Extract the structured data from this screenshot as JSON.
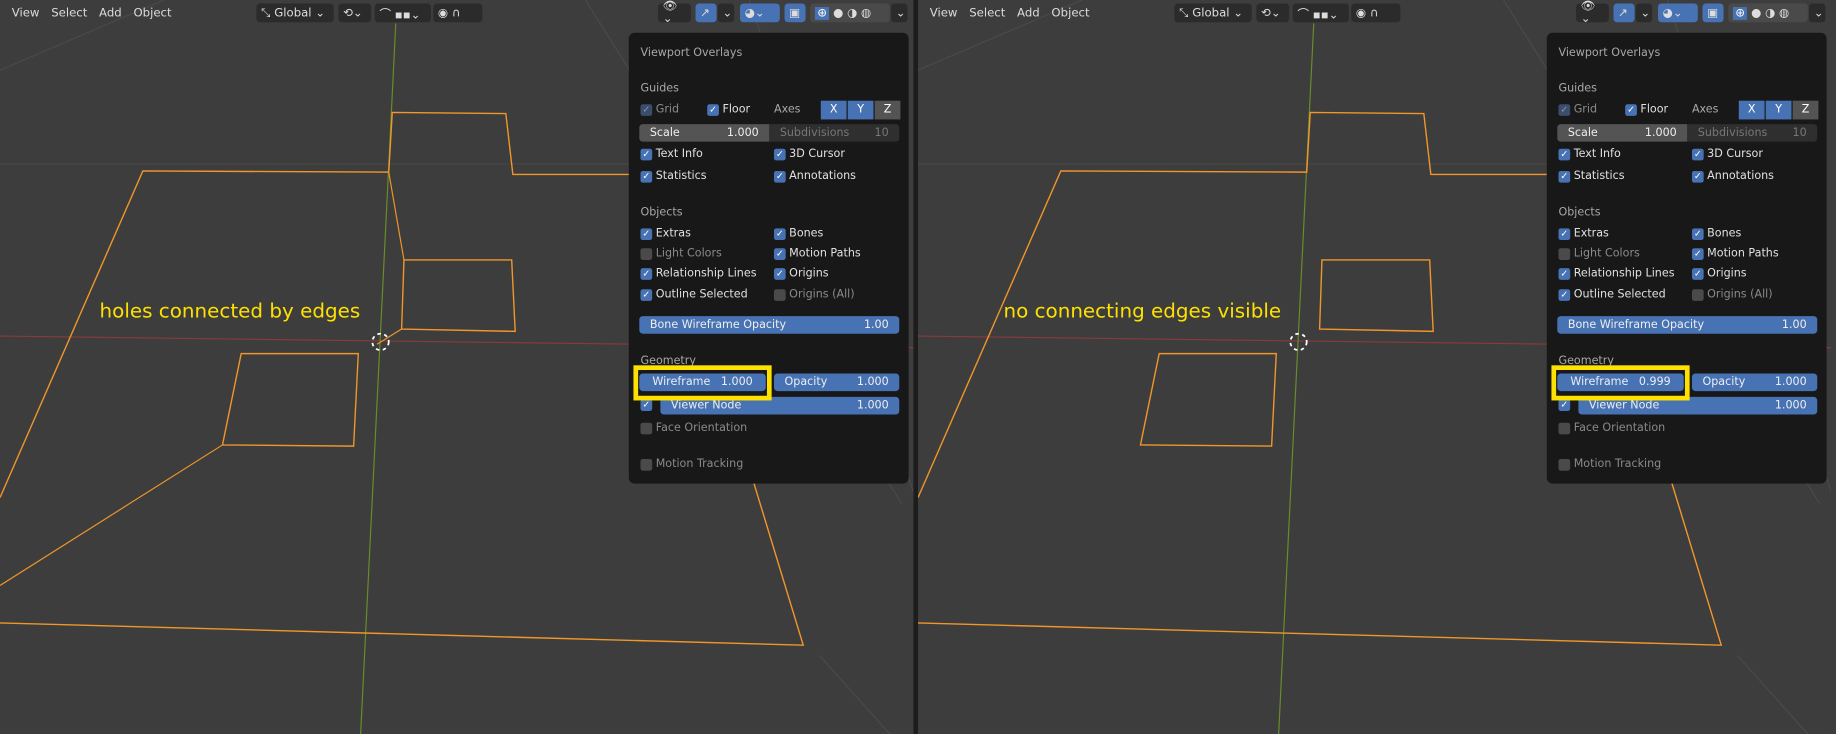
{
  "header": {
    "menus": [
      "View",
      "Select",
      "Add",
      "Object"
    ],
    "transform_orientation": "Global"
  },
  "panel": {
    "title": "Viewport Overlays",
    "guides": {
      "label": "Guides",
      "grid": "Grid",
      "floor": "Floor",
      "axes": "Axes",
      "axis_buttons": [
        "X",
        "Y",
        "Z"
      ],
      "scale_label": "Scale",
      "scale_value": "1.000",
      "subdivisions_label": "Subdivisions",
      "subdivisions_value": "10",
      "text_info": "Text Info",
      "cursor": "3D Cursor",
      "statistics": "Statistics",
      "annotations": "Annotations"
    },
    "objects": {
      "label": "Objects",
      "extras": "Extras",
      "bones": "Bones",
      "light_colors": "Light Colors",
      "motion_paths": "Motion Paths",
      "relationship_lines": "Relationship Lines",
      "origins": "Origins",
      "outline_selected": "Outline Selected",
      "origins_all": "Origins (All)",
      "bone_opacity_label": "Bone Wireframe Opacity",
      "bone_opacity_value": "1.00"
    },
    "geometry": {
      "label": "Geometry",
      "wireframe_label": "Wireframe",
      "opacity_label": "Opacity",
      "opacity_value": "1.000",
      "viewer_node_label": "Viewer Node",
      "viewer_node_value": "1.000",
      "face_orientation": "Face Orientation",
      "motion_tracking": "Motion Tracking"
    }
  },
  "left": {
    "wireframe_value": "1.000",
    "annotation": "holes connected by edges"
  },
  "right": {
    "wireframe_value": "0.999",
    "annotation": "no connecting edges visible"
  },
  "colors": {
    "accent": "#4772b3",
    "highlight": "#ffe100",
    "wire": "#f0962a"
  }
}
